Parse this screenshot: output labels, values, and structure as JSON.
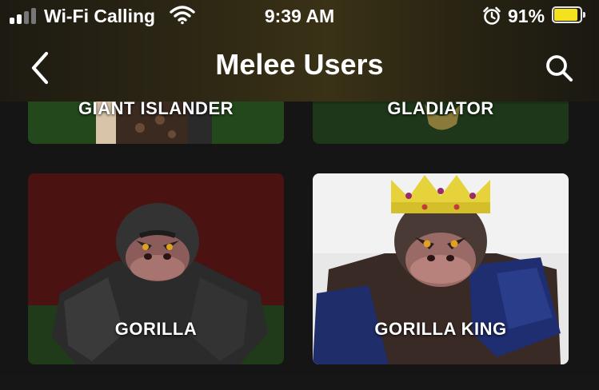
{
  "status_bar": {
    "carrier": "Wi-Fi Calling",
    "time": "9:39 AM",
    "battery_percent": "91%",
    "battery_level": 0.91,
    "signal_bars_filled": 2,
    "signal_bars_total": 4,
    "icons": [
      "signal-icon",
      "wifi-icon",
      "alarm-icon",
      "battery-icon"
    ]
  },
  "nav": {
    "title": "Melee Users",
    "back_icon": "chevron-left-icon",
    "search_icon": "search-icon"
  },
  "cards": [
    {
      "label": "GIANT ISLANDER"
    },
    {
      "label": "GLADIATOR"
    },
    {
      "label": "GORILLA"
    },
    {
      "label": "GORILLA KING"
    }
  ],
  "colors": {
    "battery_fill": "#f5e21f",
    "text": "#ffffff",
    "background": "#151515"
  }
}
